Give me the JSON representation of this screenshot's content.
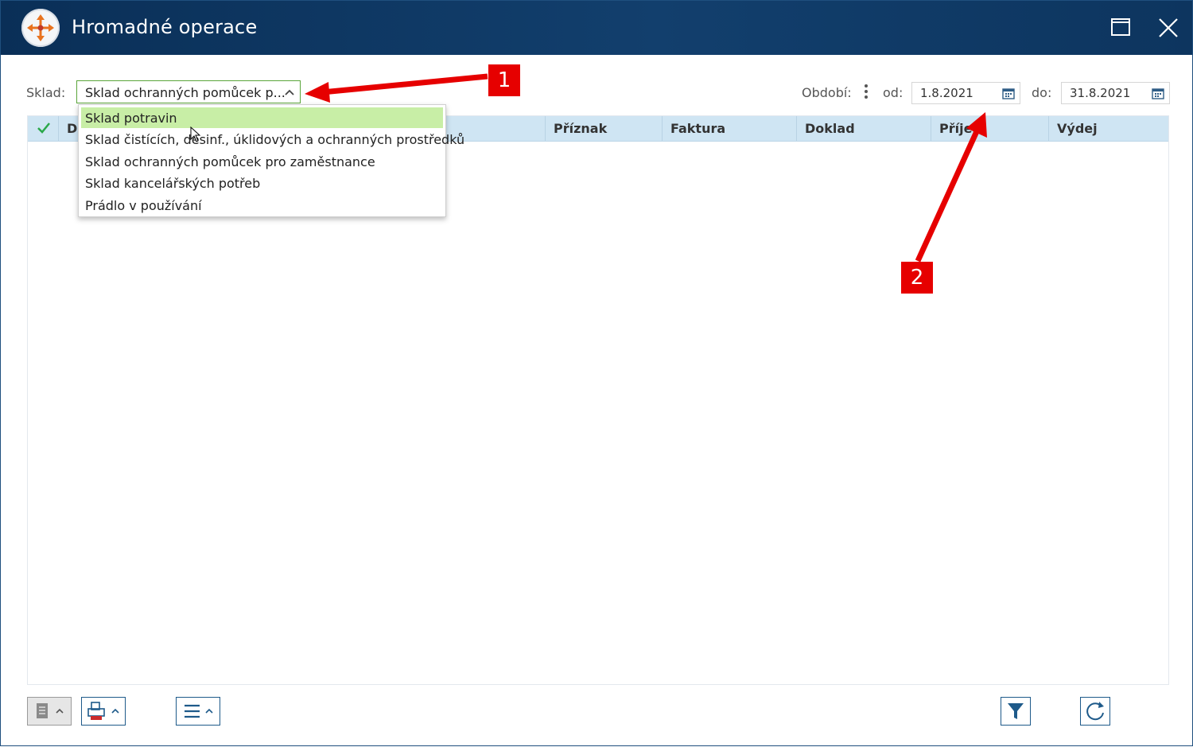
{
  "window": {
    "title": "Hromadné operace",
    "icon": "app-compass-icon",
    "controls": [
      "maximize-icon",
      "close-icon"
    ]
  },
  "filters": {
    "warehouse_label": "Sklad:",
    "warehouse_value": "Sklad ochranných pomůcek p...",
    "period_label": "Období:",
    "from_label": "od:",
    "from_value": "1.8.2021",
    "to_label": "do:",
    "to_value": "31.8.2021"
  },
  "dropdown": {
    "items": [
      {
        "label": "Sklad potravin",
        "selected": true
      },
      {
        "label": "Sklad čistících, desinf., úklidových a ochranných prostředků",
        "selected": false
      },
      {
        "label": "Sklad ochranných pomůcek pro zaměstnance",
        "selected": false
      },
      {
        "label": "Sklad kancelářských potřeb",
        "selected": false
      },
      {
        "label": "Prádlo v používání",
        "selected": false
      }
    ]
  },
  "grid": {
    "columns": [
      "D",
      "Příznak",
      "Faktura",
      "Doklad",
      "Příjem",
      "Výdej"
    ]
  },
  "annotations": {
    "one": "1",
    "two": "2"
  },
  "colors": {
    "titlebar": "#0a2f57",
    "accent_border": "#5aa53a",
    "selected_item": "#c8eea6",
    "header_bg": "#cfe5f3",
    "annotation": "#e60000"
  }
}
